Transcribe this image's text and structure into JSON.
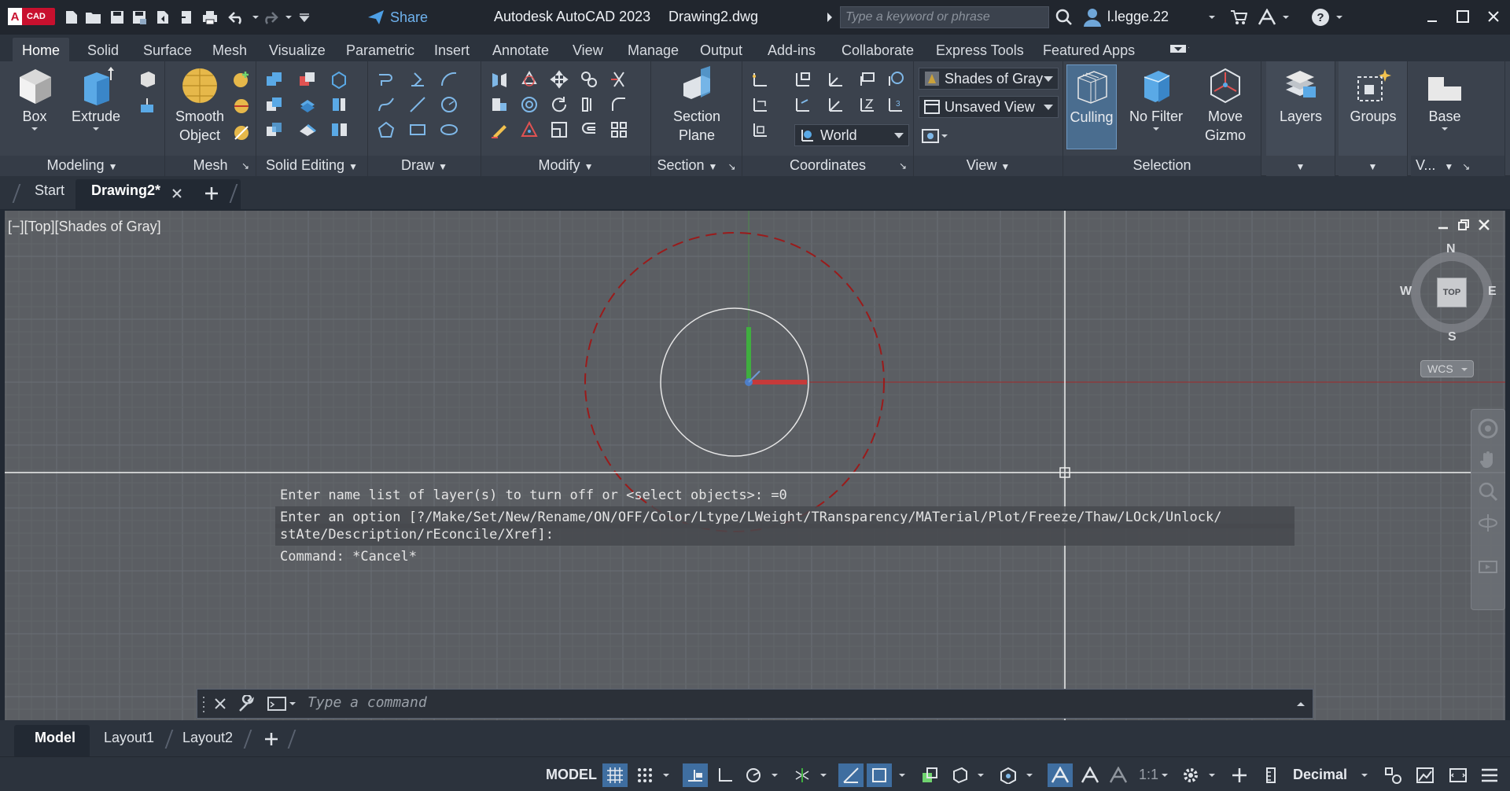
{
  "titlebar": {
    "logo_text": "CAD",
    "share_label": "Share",
    "app_title": "Autodesk AutoCAD 2023",
    "file_title": "Drawing2.dwg",
    "search_placeholder": "Type a keyword or phrase",
    "user_name": "l.legge.22"
  },
  "ribbon_tabs": [
    "Home",
    "Solid",
    "Surface",
    "Mesh",
    "Visualize",
    "Parametric",
    "Insert",
    "Annotate",
    "View",
    "Manage",
    "Output",
    "Add-ins",
    "Collaborate",
    "Express Tools",
    "Featured Apps"
  ],
  "panels": {
    "modeling": {
      "title": "Modeling",
      "box": "Box",
      "extrude": "Extrude",
      "smooth_1": "Smooth",
      "smooth_2": "Object"
    },
    "mesh": {
      "title": "Mesh"
    },
    "solid_editing": {
      "title": "Solid Editing"
    },
    "draw": {
      "title": "Draw"
    },
    "modify": {
      "title": "Modify"
    },
    "section": {
      "title": "Section",
      "plane_1": "Section",
      "plane_2": "Plane"
    },
    "coordinates": {
      "title": "Coordinates",
      "ucs_value": "World"
    },
    "view": {
      "title": "View",
      "visual_style": "Shades of Gray",
      "named_view": "Unsaved View"
    },
    "selection": {
      "title": "Selection",
      "culling": "Culling",
      "no_filter": "No Filter",
      "move_1": "Move",
      "move_2": "Gizmo"
    },
    "layers": {
      "title": "Layers"
    },
    "groups": {
      "title": "Groups"
    },
    "base": {
      "title": "V...",
      "label": "Base"
    }
  },
  "file_tabs": {
    "start": "Start",
    "drawing": "Drawing2*"
  },
  "viewport": {
    "label": "[−][Top][Shades of Gray]",
    "viewcube": {
      "n": "N",
      "s": "S",
      "e": "E",
      "w": "W",
      "face": "TOP",
      "wcs": "WCS"
    }
  },
  "command": {
    "history": [
      "Enter name list of layer(s) to turn off or <select objects>: =0",
      "Enter an option [?/Make/Set/New/Rename/ON/OFF/Color/Ltype/LWeight/TRansparency/MATerial/Plot/Freeze/Thaw/LOck/Unlock/",
      "stAte/Description/rEconcile/Xref]:",
      "Command: *Cancel*"
    ],
    "placeholder": "Type a command"
  },
  "layout_tabs": [
    "Model",
    "Layout1",
    "Layout2"
  ],
  "statusbar": {
    "model": "MODEL",
    "scale": "1:1",
    "units": "Decimal"
  },
  "colors": {
    "accent": "#3f6ea0",
    "viewport_bg": "#5b5e63",
    "red_circle": "#9a1b1b",
    "logo": "#c8102e"
  }
}
